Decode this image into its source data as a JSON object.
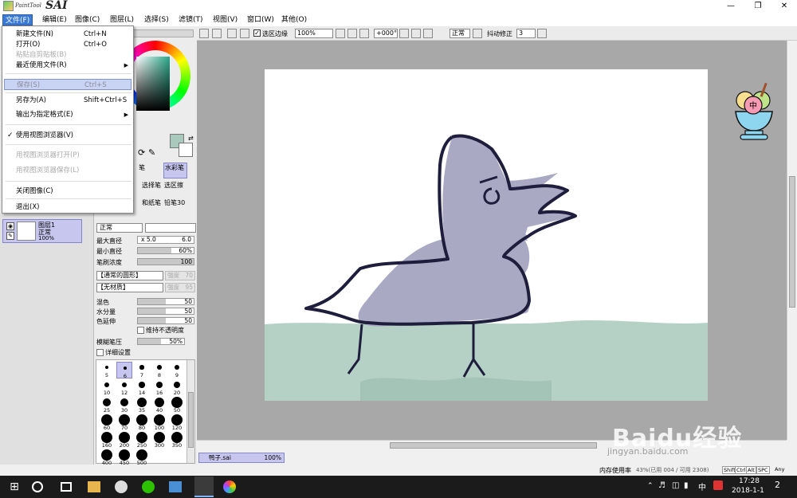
{
  "app": {
    "logo_small": "PaintTool",
    "logo_big": "SAI"
  },
  "menubar": {
    "items": [
      "文件(F)",
      "编辑(E)",
      "图像(C)",
      "图层(L)",
      "选择(S)",
      "滤镜(T)",
      "视图(V)",
      "窗口(W)",
      "其他(O)"
    ]
  },
  "file_menu": {
    "items": [
      {
        "label": "新建文件(N)",
        "shortcut": "Ctrl+N"
      },
      {
        "label": "打开(O)",
        "shortcut": "Ctrl+O"
      },
      {
        "label": "粘贴自剪贴板(B)",
        "shortcut": ""
      },
      {
        "label": "最近使用文件(R)",
        "shortcut": ""
      },
      {
        "label": "保存(S)",
        "shortcut": "Ctrl+S"
      },
      {
        "label": "另存为(A)",
        "shortcut": "Shift+Ctrl+S"
      },
      {
        "label": "输出为指定格式(E)",
        "shortcut": ""
      },
      {
        "label": "使用视图浏览器(V)",
        "shortcut": ""
      },
      {
        "label": "用视图浏览器打开(P)",
        "shortcut": ""
      },
      {
        "label": "用视图浏览器保存(L)",
        "shortcut": ""
      },
      {
        "label": "关闭图像(C)",
        "shortcut": ""
      },
      {
        "label": "退出(X)",
        "shortcut": ""
      }
    ]
  },
  "toolbar": {
    "selection_edge": "选区边缘",
    "zoom": "100%",
    "rotation": "+000°",
    "blend_mode": "正常",
    "stabilizer_label": "抖动修正",
    "stabilizer": "3"
  },
  "tools": {
    "t1": "笔",
    "t2": "水彩笔",
    "t3": "选择笔",
    "t4": "选区擦",
    "t5": "和纸笔",
    "t6": "铅笔30"
  },
  "brush": {
    "mode": "正常",
    "max_size_label": "最大直径",
    "max_size_mult": "x 5.0",
    "max_size": "6.0",
    "min_size_label": "最小直径",
    "min_size": "60%",
    "min_size_fraction": 0.6,
    "density_label": "笔刷浓度",
    "density": "100",
    "density_fraction": 1.0,
    "shape": "【通常的圆形】",
    "shape_strength_label": "强度",
    "shape_strength": "70",
    "texture": "【无材质】",
    "texture_strength_label": "强度",
    "texture_strength": "95",
    "blend_label": "混色",
    "blend": "50",
    "blend_fraction": 0.5,
    "water_label": "水分量",
    "water": "50",
    "water_fraction": 0.5,
    "persistence_label": "色延伸",
    "persistence": "50",
    "persistence_fraction": 0.5,
    "keep_opacity": "维持不透明度",
    "blur_label": "模糊笔压",
    "blur": "50%",
    "blur_fraction": 0.5,
    "advanced": "详细设置",
    "sizes": [
      "5",
      "6",
      "7",
      "8",
      "9",
      "10",
      "12",
      "14",
      "16",
      "20",
      "25",
      "30",
      "35",
      "40",
      "50",
      "60",
      "70",
      "80",
      "100",
      "120",
      "160",
      "200",
      "250",
      "300",
      "350",
      "400",
      "450",
      "500"
    ]
  },
  "layer": {
    "name": "图层1",
    "mode": "正常",
    "opacity": "100%"
  },
  "document": {
    "tab": "鸭子.sai",
    "zoom": "100%"
  },
  "status": {
    "memory": "内存使用率",
    "memory_detail": "43%(已用 004 / 可用 2308)",
    "keys": [
      "Shift",
      "Ctrl",
      "Alt",
      "SPC"
    ],
    "any": "Any"
  },
  "taskbar": {
    "time": "17:28",
    "date": "2018-1-1",
    "ime": "中",
    "notifications": "2"
  },
  "watermark": {
    "text": "Baidu经验",
    "sub": "jingyan.baidu.com"
  },
  "colors": {
    "accent": "#3b7bd6",
    "layer_sel": "#c6c6ef",
    "duck": "#a9a9c4",
    "grass": "#a8c9bc"
  }
}
